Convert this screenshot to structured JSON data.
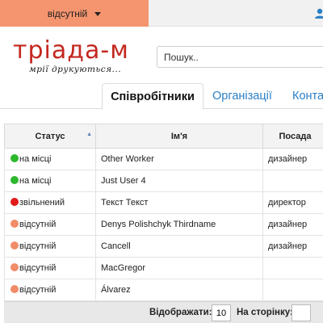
{
  "colors": {
    "status_dropdown_bg": "#f4956f",
    "logo_red": "#c3281f",
    "link_blue": "#2b7fc5",
    "dot_green": "#2db82d",
    "dot_red": "#e11b1b",
    "dot_orange": "#f08c68"
  },
  "topbar": {
    "status_label": "відсутній",
    "user_icon": "user-icon"
  },
  "logo": {
    "title": "тріада-м",
    "tagline": "мрії друкуються..."
  },
  "search": {
    "placeholder": "Пошук.."
  },
  "tabs": [
    {
      "label": "Співробітники",
      "active": true
    },
    {
      "label": "Організації",
      "active": false
    },
    {
      "label": "Конта",
      "active": false
    }
  ],
  "table": {
    "columns": [
      "Статус",
      "Ім'я",
      "Посада"
    ],
    "rows": [
      {
        "status": "на місці",
        "status_color": "green",
        "name": "Other Worker",
        "position": "дизайнер"
      },
      {
        "status": "на місці",
        "status_color": "green",
        "name": "Just User 4",
        "position": ""
      },
      {
        "status": "звільнений",
        "status_color": "red",
        "name": "Текст Текст",
        "position": "директор"
      },
      {
        "status": "відсутній",
        "status_color": "orange",
        "name": "Denys Polishchyk Thirdname",
        "position": "дизайнер"
      },
      {
        "status": "відсутній",
        "status_color": "orange",
        "name": "Cancell",
        "position": "дизайнер"
      },
      {
        "status": "відсутній",
        "status_color": "orange",
        "name": "MacGregor",
        "position": ""
      },
      {
        "status": "відсутній",
        "status_color": "orange",
        "name": "Álvarez",
        "position": ""
      }
    ]
  },
  "footer": {
    "per_page_label": "Відображати:",
    "per_page_value": "10",
    "page_label": "На сторінку:",
    "page_value": ""
  }
}
